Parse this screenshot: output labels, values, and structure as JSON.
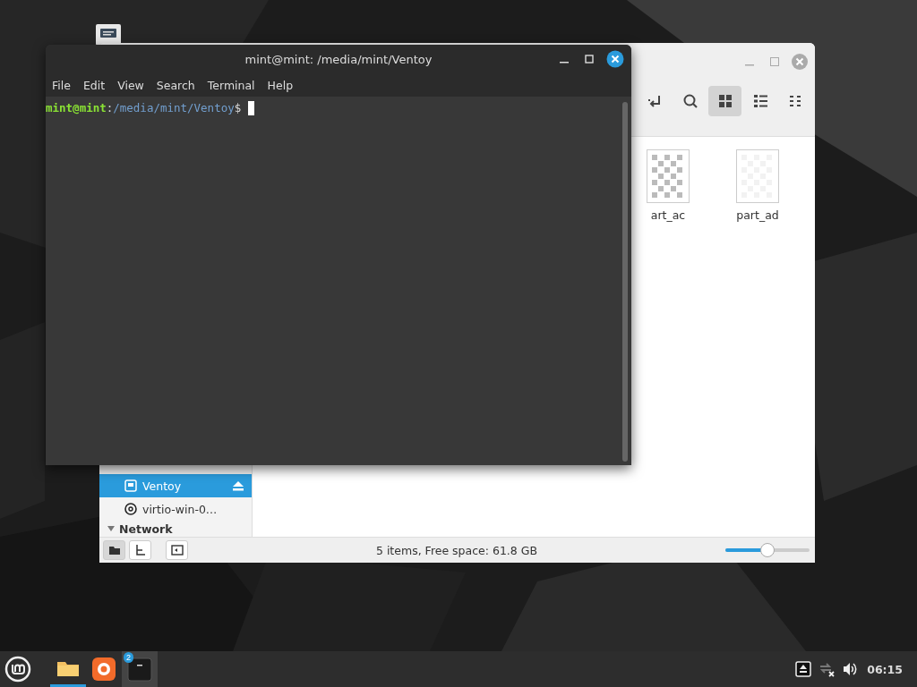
{
  "file_manager": {
    "views": [
      {
        "kind": "grid",
        "selected": true
      },
      {
        "kind": "list",
        "selected": false
      },
      {
        "kind": "compact",
        "selected": false
      }
    ],
    "files": [
      {
        "name": "art_ac",
        "kind": "checker"
      },
      {
        "name": "part_ad",
        "kind": "blank"
      }
    ],
    "sidebar": {
      "items": [
        {
          "label": "Ventoy",
          "kind": "drive",
          "selected": true,
          "eject": true
        },
        {
          "label": "virtio-win-0…",
          "kind": "disc",
          "selected": false,
          "eject": false
        }
      ],
      "section": {
        "label": "Network",
        "expanded": true
      }
    },
    "status_buttons": [
      {
        "kind": "places",
        "selected": true
      },
      {
        "kind": "tree",
        "selected": false
      },
      {
        "kind": "sidebar",
        "selected": false
      }
    ],
    "status": "5 items, Free space: 61.8 GB",
    "zoom": {
      "level": 0.5
    }
  },
  "terminal": {
    "title": "mint@mint: /media/mint/Ventoy",
    "menu": [
      "File",
      "Edit",
      "View",
      "Search",
      "Terminal",
      "Help"
    ],
    "prompt": {
      "user": "mint@mint",
      "separator": ":",
      "path": "/media/mint/Ventoy",
      "symbol": "$"
    }
  },
  "taskbar": {
    "apps": [
      {
        "kind": "files",
        "active": true
      },
      {
        "kind": "browser",
        "active": false
      },
      {
        "kind": "terminal",
        "active": true,
        "badge": "2"
      }
    ],
    "clock": "06:15"
  }
}
